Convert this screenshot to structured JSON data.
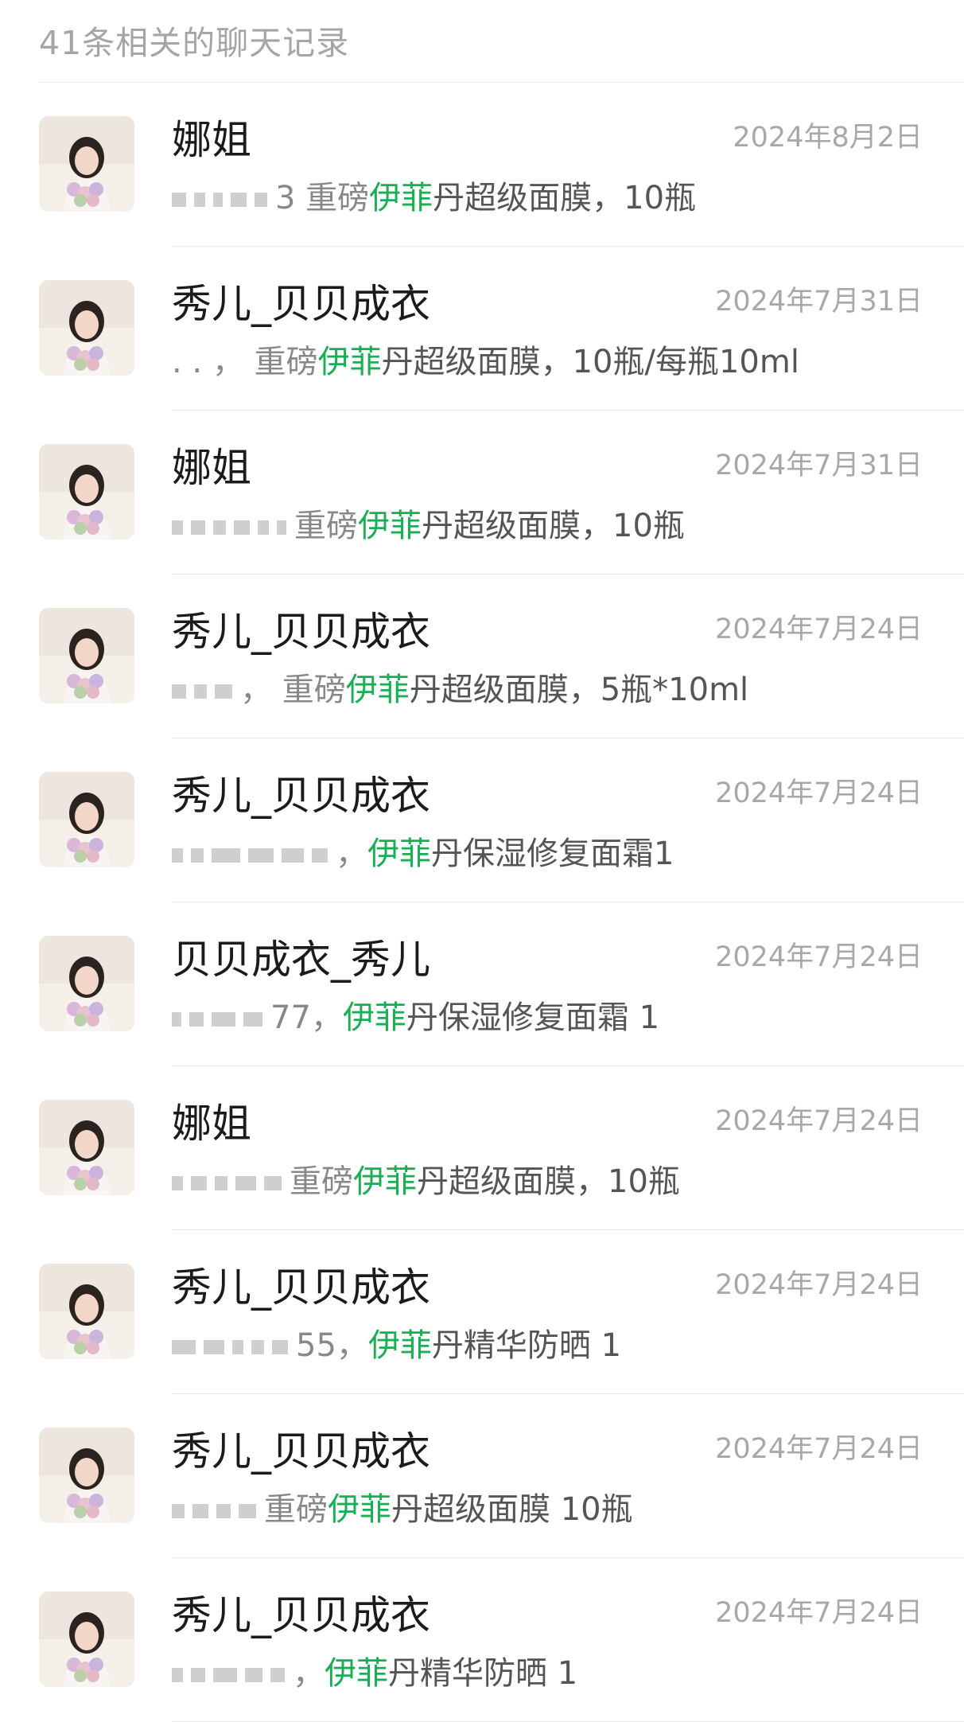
{
  "header": {
    "title": "41条相关的聊天记录"
  },
  "colors": {
    "highlight": "#1aaf55",
    "date": "#a8a8a8",
    "name": "#1b1b1b"
  },
  "items": [
    {
      "name": "娜姐",
      "date": "2024年8月2日",
      "pre": "3 重磅",
      "hl": "伊菲",
      "post": "丹超级面膜，10瓶",
      "blur": [
        18,
        14,
        12,
        20,
        16
      ]
    },
    {
      "name": "秀儿_贝贝成衣",
      "date": "2024年7月31日",
      "pre": ". .  ，  重磅",
      "hl": "伊菲",
      "post": "丹超级面膜，10瓶/每瓶10ml",
      "blur": []
    },
    {
      "name": "娜姐",
      "date": "2024年7月31日",
      "pre": "重磅",
      "hl": "伊菲",
      "post": "丹超级面膜，10瓶",
      "blur": [
        14,
        18,
        16,
        20,
        14,
        12
      ]
    },
    {
      "name": "秀儿_贝贝成衣",
      "date": "2024年7月24日",
      "pre": "，  重磅",
      "hl": "伊菲",
      "post": "丹超级面膜，5瓶*10ml",
      "blur": [
        18,
        16,
        22
      ]
    },
    {
      "name": "秀儿_贝贝成衣",
      "date": "2024年7月24日",
      "pre": "，  ",
      "hl": "伊菲",
      "post": "丹保湿修复面霜1",
      "blur": [
        14,
        16,
        36,
        32,
        28,
        20
      ]
    },
    {
      "name": "贝贝成衣_秀儿",
      "date": "2024年7月24日",
      "pre": "77，  ",
      "hl": "伊菲",
      "post": "丹保湿修复面霜 1",
      "blur": [
        12,
        18,
        30,
        24
      ]
    },
    {
      "name": "娜姐",
      "date": "2024年7月24日",
      "pre": "重磅",
      "hl": "伊菲",
      "post": "丹超级面膜，10瓶",
      "blur": [
        14,
        20,
        16,
        26,
        22
      ]
    },
    {
      "name": "秀儿_贝贝成衣",
      "date": "2024年7月24日",
      "pre": "55，  ",
      "hl": "伊菲",
      "post": "丹精华防晒  1",
      "blur": [
        30,
        26,
        14,
        16,
        20
      ]
    },
    {
      "name": "秀儿_贝贝成衣",
      "date": "2024年7月24日",
      "pre": "重磅",
      "hl": "伊菲",
      "post": "丹超级面膜 10瓶",
      "blur": [
        16,
        20,
        18,
        22
      ]
    },
    {
      "name": "秀儿_贝贝成衣",
      "date": "2024年7月24日",
      "pre": "，  ",
      "hl": "伊菲",
      "post": "丹精华防晒 1",
      "blur": [
        14,
        18,
        30,
        22,
        18
      ]
    }
  ]
}
